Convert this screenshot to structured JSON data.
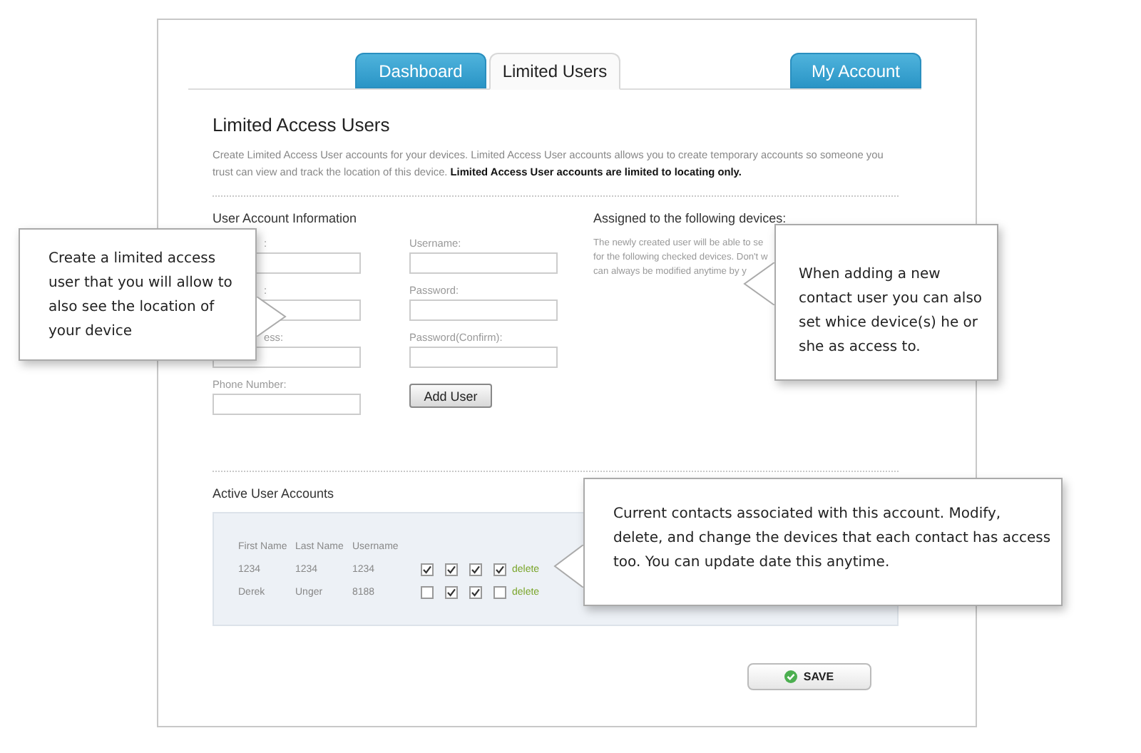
{
  "tabs": [
    {
      "label": "Dashboard",
      "selected": false
    },
    {
      "label": "Limited Users",
      "selected": true
    }
  ],
  "account_tab": {
    "label": "My Account",
    "selected": false
  },
  "heading": "Limited Access Users",
  "intro": "Create Limited Access User accounts for your devices. Limited Access User accounts allows you to create temporary accounts so someone you trust can view and track the location of this device. **Limited Access User accounts are limited to locating only.**",
  "account_info": {
    "title": "User Account Information",
    "left_fields": [
      {
        "label": ":"
      },
      {
        "label": ":"
      },
      {
        "label": "ess:"
      },
      {
        "label": "Phone Number:"
      }
    ],
    "right_fields": [
      {
        "label": "Username:"
      },
      {
        "label": "Password:"
      },
      {
        "label": "Password(Confirm):"
      }
    ],
    "button": "Add User"
  },
  "devices": {
    "title": "Assigned to the following devices:",
    "lines": [
      "The newly created user will be able to se",
      "for the following checked devices. Don't w",
      "can always be modified anytime by y"
    ]
  },
  "accounts": {
    "title": "Active User Accounts",
    "columns": [
      "First Name",
      "Last Name",
      "Username"
    ],
    "rows": [
      {
        "cells": [
          "1234",
          "1234",
          "1234"
        ],
        "devices": [
          {
            "checked": true
          },
          {
            "checked": true
          },
          {
            "checked": true
          },
          {
            "checked": true
          }
        ],
        "action": "delete"
      },
      {
        "cells": [
          "Derek",
          "Unger",
          "8188"
        ],
        "devices": [
          {
            "checked": false
          },
          {
            "checked": true
          },
          {
            "checked": true
          },
          {
            "checked": false
          }
        ],
        "action": "delete"
      }
    ]
  },
  "save_button": "SAVE",
  "callouts": [
    {
      "text": "Create a limited access user that you will allow to also see the location of your device"
    },
    {
      "text": "When adding a new contact user you can also set whice device(s) he or she as access to."
    },
    {
      "text": "Current contacts associated with this account. Modify, delete, and change the devices that each contact has access too. You can update date this anytime."
    }
  ]
}
